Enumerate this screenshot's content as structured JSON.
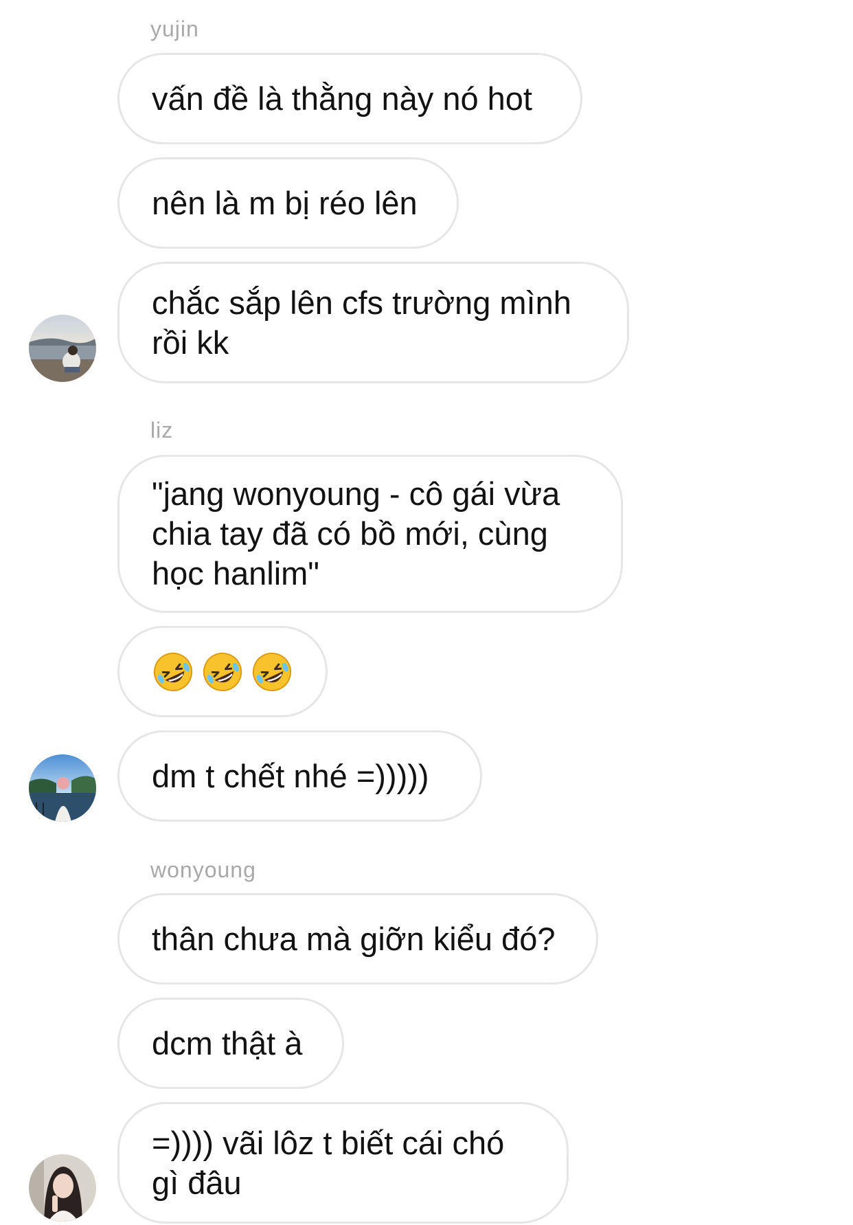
{
  "groups": [
    {
      "sender": "yujin",
      "messages": [
        "vấn đề là thằng này nó hot",
        "nên là m bị réo lên",
        "chắc sắp lên cfs trường mình\nrồi kk"
      ]
    },
    {
      "sender": "liz",
      "messages": [
        "\"jang wonyoung - cô gái vừa\nchia tay đã có bồ mới, cùng\nhọc hanlim\"",
        "dm t chết nhé =)))))"
      ],
      "emoji_message": [
        "rolling-on-floor-laughing",
        "rolling-on-floor-laughing",
        "rolling-on-floor-laughing"
      ]
    },
    {
      "sender": "wonyoung",
      "messages": [
        "thân chưa mà giỡn kiểu đó?",
        "dcm thật à",
        "=)))) vãi lôz t biết cái chó\ngì đâu"
      ]
    }
  ],
  "colors": {
    "bubble_border": "#e6e6e6",
    "sender_name": "#a8a8a8",
    "message_text": "#121212",
    "emoji_face": "#f7c22b"
  }
}
